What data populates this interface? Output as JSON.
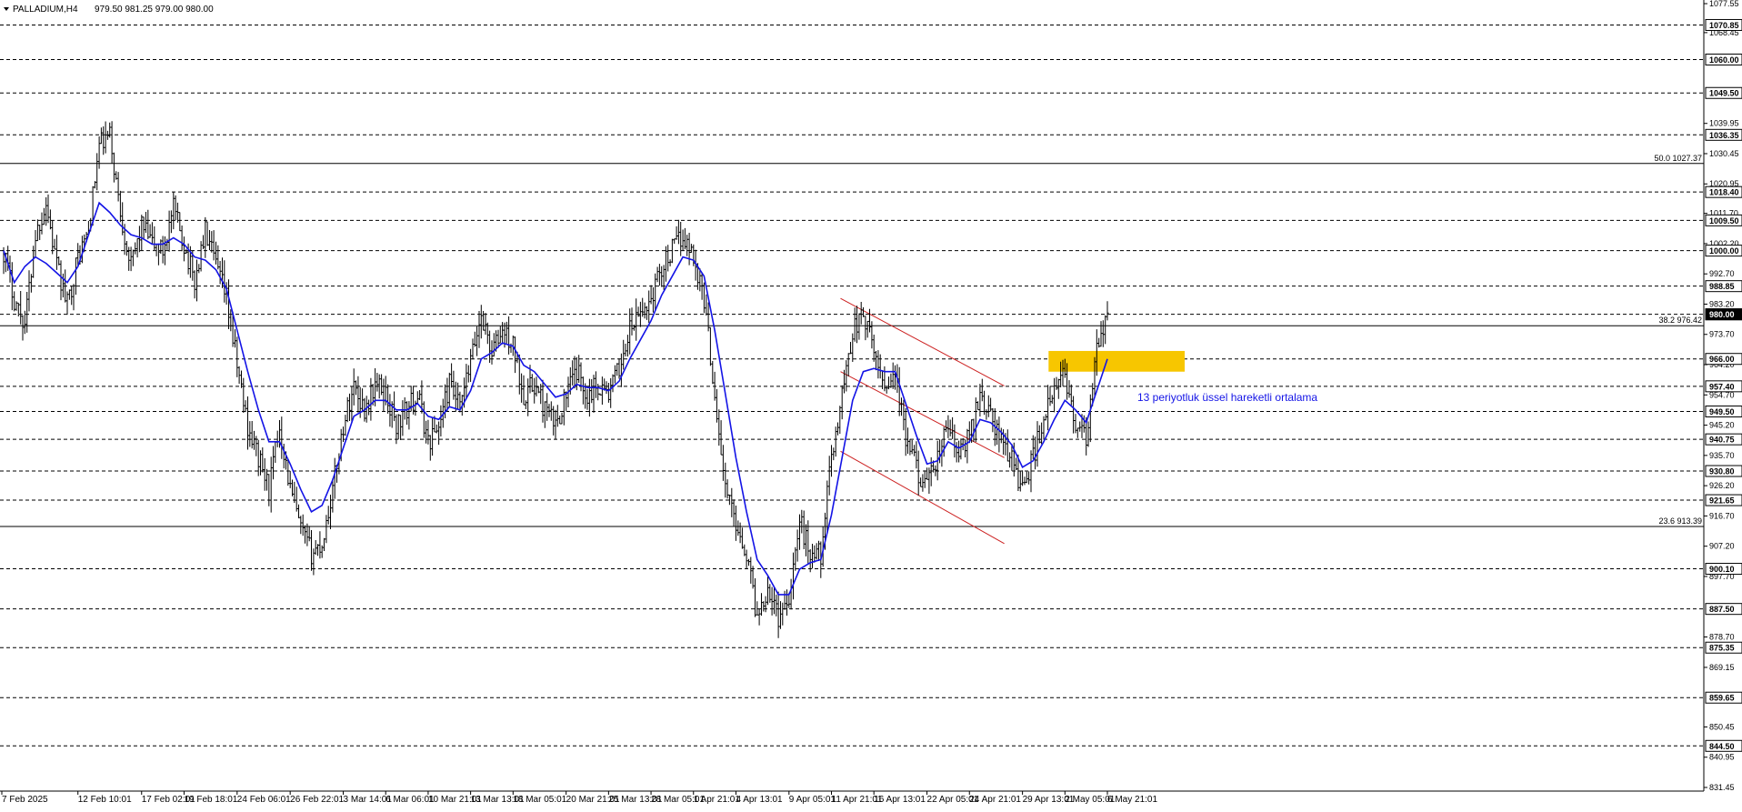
{
  "header": {
    "symbol_label": "PALLADIUM,H4",
    "ohlc_text": "979.50 981.25 979.00 980.00"
  },
  "colors": {
    "background": "#ffffff",
    "candle": "#000000",
    "ema": "#1414e6",
    "channel": "#cc2020",
    "zone_fill": "#f7c600",
    "level_line": "#000000",
    "annotation_text": "#1414e6"
  },
  "chart_data": {
    "type": "candlestick",
    "title": "PALLADIUM,H4",
    "ylim": [
      831.45,
      1077.55
    ],
    "y_ticks": [
      "1077.55",
      "1068.45",
      "1039.95",
      "1030.45",
      "1020.95",
      "1011.70",
      "1002.20",
      "992.70",
      "983.20",
      "973.70",
      "964.20",
      "954.70",
      "945.20",
      "935.70",
      "926.20",
      "916.70",
      "907.20",
      "897.70",
      "878.70",
      "869.15",
      "850.45",
      "840.95",
      "831.45"
    ],
    "x_ticks": [
      "7 Feb 2025",
      "12 Feb 10:01",
      "17 Feb 02:01",
      "19 Feb 18:01",
      "24 Feb 06:01",
      "26 Feb 22:01",
      "3 Mar 14:01",
      "6 Mar 06:01",
      "10 Mar 21:01",
      "13 Mar 13:01",
      "18 Mar 05:01",
      "20 Mar 21:01",
      "25 Mar 13:01",
      "28 Mar 05:01",
      "1 Apr 21:01",
      "4 Apr 13:01",
      "9 Apr 05:01",
      "11 Apr 21:01",
      "16 Apr 13:01",
      "22 Apr 05:01",
      "24 Apr 21:01",
      "29 Apr 13:01",
      "2 May 05:01",
      "6 May 21:01"
    ],
    "horizontal_levels": [
      "1070.85",
      "1060.00",
      "1049.50",
      "1036.35",
      "1018.40",
      "1009.50",
      "1000.00",
      "988.85",
      "980.00",
      "966.00",
      "957.40",
      "949.50",
      "940.75",
      "930.80",
      "921.65",
      "900.10",
      "887.50",
      "875.35",
      "859.65",
      "844.50"
    ],
    "current_price": "980.00",
    "fibonacci": [
      {
        "label": "50.0 1027.37",
        "value": 1027.37
      },
      {
        "label": "38.2 976.42",
        "value": 976.42
      },
      {
        "label": "23.6 913.39",
        "value": 913.39
      }
    ],
    "series": [
      {
        "name": "PALLADIUM,H4",
        "kind": "ohlc-path",
        "points": [
          [
            "7 Feb 2025",
            1000
          ],
          [
            "",
            985
          ],
          [
            "",
            977
          ],
          [
            "",
            1005
          ],
          [
            "",
            1015
          ],
          [
            "",
            995
          ],
          [
            "",
            983
          ],
          [
            "12 Feb 10:01",
            998
          ],
          [
            "",
            1006
          ],
          [
            "",
            1033
          ],
          [
            "",
            1036
          ],
          [
            "",
            1012
          ],
          [
            "",
            995
          ],
          [
            "17 Feb 02:01",
            1008
          ],
          [
            "",
            1002
          ],
          [
            "",
            1000
          ],
          [
            "",
            1013
          ],
          [
            "19 Feb 18:01",
            1002
          ],
          [
            "",
            990
          ],
          [
            "",
            1006
          ],
          [
            "",
            995
          ],
          [
            "",
            985
          ],
          [
            "24 Feb 06:01",
            964
          ],
          [
            "",
            945
          ],
          [
            "",
            935
          ],
          [
            "",
            925
          ],
          [
            "",
            945
          ],
          [
            "26 Feb 22:01",
            925
          ],
          [
            "",
            912
          ],
          [
            "",
            905
          ],
          [
            "",
            908
          ],
          [
            "",
            925
          ],
          [
            "3 Mar 14:01",
            945
          ],
          [
            "",
            958
          ],
          [
            "",
            950
          ],
          [
            "",
            958
          ],
          [
            "6 Mar 06:01",
            955
          ],
          [
            "",
            945
          ],
          [
            "",
            950
          ],
          [
            "",
            955
          ],
          [
            "10 Mar 21:01",
            940
          ],
          [
            "",
            945
          ],
          [
            "",
            958
          ],
          [
            "",
            950
          ],
          [
            "13 Mar 13:01",
            965
          ],
          [
            "",
            980
          ],
          [
            "",
            968
          ],
          [
            "",
            975
          ],
          [
            "18 Mar 05:01",
            970
          ],
          [
            "",
            955
          ],
          [
            "",
            958
          ],
          [
            "",
            950
          ],
          [
            "",
            945
          ],
          [
            "20 Mar 21:01",
            955
          ],
          [
            "",
            962
          ],
          [
            "",
            955
          ],
          [
            "",
            958
          ],
          [
            "25 Mar 13:01",
            955
          ],
          [
            "",
            963
          ],
          [
            "",
            975
          ],
          [
            "",
            980
          ],
          [
            "28 Mar 05:01",
            985
          ],
          [
            "",
            995
          ],
          [
            "",
            1000
          ],
          [
            "",
            1005
          ],
          [
            "1 Apr 21:01",
            998
          ],
          [
            "",
            985
          ],
          [
            "",
            955
          ],
          [
            "",
            925
          ],
          [
            "4 Apr 13:01",
            915
          ],
          [
            "",
            905
          ],
          [
            "",
            885
          ],
          [
            "",
            895
          ],
          [
            "",
            885
          ],
          [
            "9 Apr 05:01",
            892
          ],
          [
            "",
            915
          ],
          [
            "",
            905
          ],
          [
            "",
            905
          ],
          [
            "11 Apr 21:01",
            935
          ],
          [
            "",
            955
          ],
          [
            "",
            975
          ],
          [
            "",
            980
          ],
          [
            "16 Apr 13:01",
            968
          ],
          [
            "",
            958
          ],
          [
            "",
            962
          ],
          [
            "",
            940
          ],
          [
            "",
            932
          ],
          [
            "22 Apr 05:01",
            925
          ],
          [
            "",
            935
          ],
          [
            "",
            945
          ],
          [
            "",
            935
          ],
          [
            "24 Apr 21:01",
            942
          ],
          [
            "",
            955
          ],
          [
            "",
            948
          ],
          [
            "",
            940
          ],
          [
            "",
            935
          ],
          [
            "29 Apr 13:01",
            925
          ],
          [
            "",
            935
          ],
          [
            "",
            948
          ],
          [
            "",
            955
          ],
          [
            "2 May 05:01",
            962
          ],
          [
            "",
            945
          ],
          [
            "",
            940
          ],
          [
            "",
            968
          ],
          [
            "6 May 21:01",
            980
          ]
        ]
      },
      {
        "name": "13 periyotluk üssel hareketli ortalama",
        "kind": "line",
        "points": [
          [
            "7 Feb 2025",
            1000
          ],
          [
            "",
            990
          ],
          [
            "",
            995
          ],
          [
            "",
            998
          ],
          [
            "",
            996
          ],
          [
            "",
            993
          ],
          [
            "",
            990
          ],
          [
            "12 Feb 10:01",
            995
          ],
          [
            "",
            1005
          ],
          [
            "",
            1015
          ],
          [
            "",
            1012
          ],
          [
            "",
            1008
          ],
          [
            "",
            1005
          ],
          [
            "17 Feb 02:01",
            1004
          ],
          [
            "",
            1002
          ],
          [
            "",
            1002
          ],
          [
            "",
            1004
          ],
          [
            "19 Feb 18:01",
            1002
          ],
          [
            "",
            998
          ],
          [
            "",
            997
          ],
          [
            "",
            994
          ],
          [
            "",
            988
          ],
          [
            "24 Feb 06:01",
            975
          ],
          [
            "",
            962
          ],
          [
            "",
            950
          ],
          [
            "",
            940
          ],
          [
            "",
            940
          ],
          [
            "26 Feb 22:01",
            933
          ],
          [
            "",
            925
          ],
          [
            "",
            918
          ],
          [
            "",
            920
          ],
          [
            "",
            928
          ],
          [
            "3 Mar 14:01",
            938
          ],
          [
            "",
            948
          ],
          [
            "",
            950
          ],
          [
            "",
            953
          ],
          [
            "6 Mar 06:01",
            953
          ],
          [
            "",
            950
          ],
          [
            "",
            950
          ],
          [
            "",
            952
          ],
          [
            "10 Mar 21:01",
            948
          ],
          [
            "",
            947
          ],
          [
            "",
            951
          ],
          [
            "",
            950
          ],
          [
            "13 Mar 13:01",
            956
          ],
          [
            "",
            966
          ],
          [
            "",
            968
          ],
          [
            "",
            971
          ],
          [
            "18 Mar 05:01",
            970
          ],
          [
            "",
            964
          ],
          [
            "",
            962
          ],
          [
            "",
            958
          ],
          [
            "",
            954
          ],
          [
            "20 Mar 21:01",
            955
          ],
          [
            "",
            958
          ],
          [
            "",
            957
          ],
          [
            "",
            957
          ],
          [
            "25 Mar 13:01",
            956
          ],
          [
            "",
            959
          ],
          [
            "",
            966
          ],
          [
            "",
            972
          ],
          [
            "28 Mar 05:01",
            978
          ],
          [
            "",
            986
          ],
          [
            "",
            992
          ],
          [
            "",
            998
          ],
          [
            "1 Apr 21:01",
            997
          ],
          [
            "",
            992
          ],
          [
            "",
            975
          ],
          [
            "",
            955
          ],
          [
            "4 Apr 13:01",
            935
          ],
          [
            "",
            918
          ],
          [
            "",
            903
          ],
          [
            "",
            898
          ],
          [
            "",
            892
          ],
          [
            "9 Apr 05:01",
            892
          ],
          [
            "",
            900
          ],
          [
            "",
            902
          ],
          [
            "",
            903
          ],
          [
            "11 Apr 21:01",
            917
          ],
          [
            "",
            935
          ],
          [
            "",
            953
          ],
          [
            "",
            962
          ],
          [
            "16 Apr 13:01",
            963
          ],
          [
            "",
            962
          ],
          [
            "",
            962
          ],
          [
            "",
            952
          ],
          [
            "",
            942
          ],
          [
            "22 Apr 05:01",
            933
          ],
          [
            "",
            934
          ],
          [
            "",
            940
          ],
          [
            "",
            938
          ],
          [
            "24 Apr 21:01",
            940
          ],
          [
            "",
            947
          ],
          [
            "",
            946
          ],
          [
            "",
            943
          ],
          [
            "",
            939
          ],
          [
            "29 Apr 13:01",
            932
          ],
          [
            "",
            934
          ],
          [
            "",
            940
          ],
          [
            "",
            947
          ],
          [
            "2 May 05:01",
            953
          ],
          [
            "",
            950
          ],
          [
            "",
            946
          ],
          [
            "",
            956
          ],
          [
            "6 May 21:01",
            966
          ]
        ]
      }
    ],
    "annotations": [
      {
        "kind": "text",
        "label": "13 periyotluk üssel hareketli ortalama",
        "x": "6 May 21:01",
        "y": 954
      },
      {
        "kind": "zone",
        "y_range": [
          962,
          968.5
        ],
        "x_range": [
          "2 May 05:01",
          "6 May 21:01"
        ]
      },
      {
        "kind": "trendline",
        "from": [
          "11 Apr 21:01",
          985
        ],
        "to": [
          "29 Apr 13:01",
          957.5
        ]
      },
      {
        "kind": "trendline",
        "from": [
          "11 Apr 21:01",
          962
        ],
        "to": [
          "29 Apr 13:01",
          935
        ]
      },
      {
        "kind": "trendline",
        "from": [
          "11 Apr 21:01",
          937
        ],
        "to": [
          "29 Apr 13:01",
          908
        ]
      }
    ]
  }
}
